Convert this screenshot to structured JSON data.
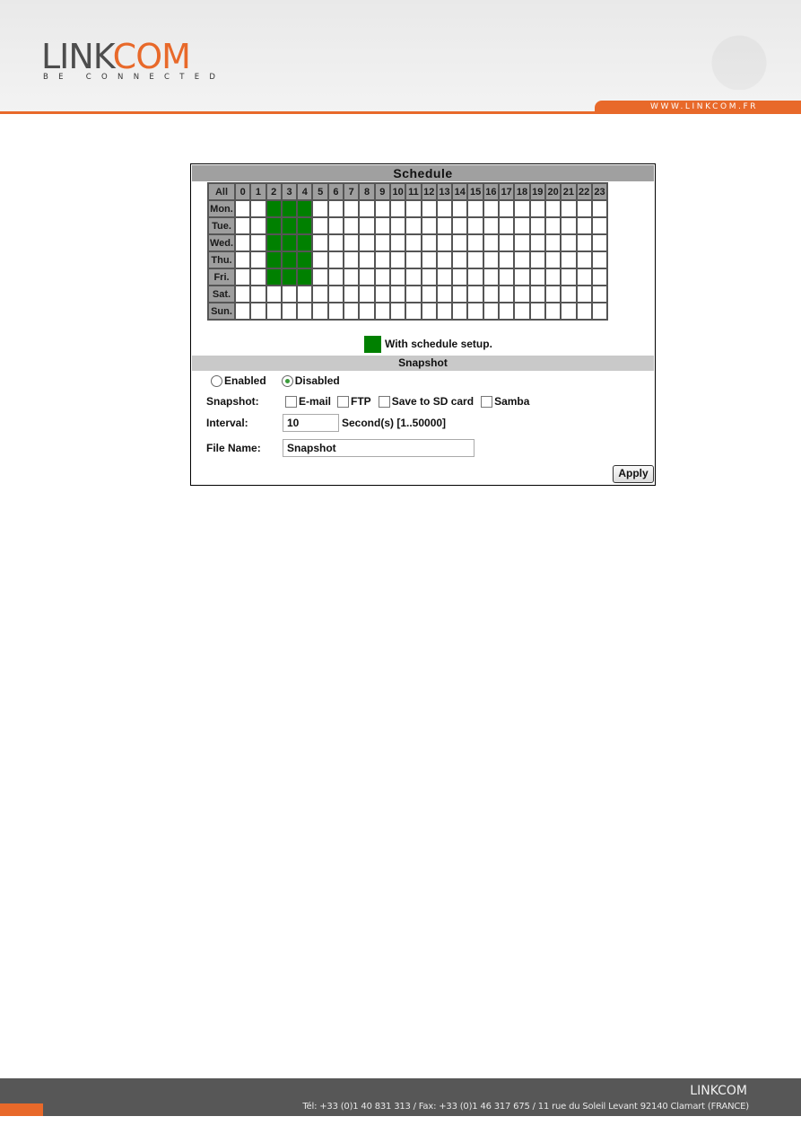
{
  "header": {
    "logo": {
      "part1": "LINK",
      "part2": "COM",
      "tagline": "BE CONNECTED"
    },
    "website": "WWW.LINKCOM.FR"
  },
  "schedule": {
    "title": "Schedule",
    "all_label": "All",
    "hours": [
      "0",
      "1",
      "2",
      "3",
      "4",
      "5",
      "6",
      "7",
      "8",
      "9",
      "10",
      "11",
      "12",
      "13",
      "14",
      "15",
      "16",
      "17",
      "18",
      "19",
      "20",
      "21",
      "22",
      "23"
    ],
    "days": [
      {
        "label": "Mon.",
        "active_hours": [
          2,
          3,
          4
        ]
      },
      {
        "label": "Tue.",
        "active_hours": [
          2,
          3,
          4
        ]
      },
      {
        "label": "Wed.",
        "active_hours": [
          2,
          3,
          4
        ]
      },
      {
        "label": "Thu.",
        "active_hours": [
          2,
          3,
          4
        ]
      },
      {
        "label": "Fri.",
        "active_hours": [
          2,
          3,
          4
        ]
      },
      {
        "label": "Sat.",
        "active_hours": []
      },
      {
        "label": "Sun.",
        "active_hours": []
      }
    ],
    "active_color": "#008000",
    "legend": "With schedule setup."
  },
  "snapshot": {
    "title": "Snapshot",
    "mode": {
      "options": [
        {
          "label": "Enabled",
          "checked": false
        },
        {
          "label": "Disabled",
          "checked": true
        }
      ]
    },
    "targets_label": "Snapshot:",
    "targets": [
      {
        "label": "E-mail",
        "checked": false
      },
      {
        "label": "FTP",
        "checked": false
      },
      {
        "label": "Save to SD card",
        "checked": false
      },
      {
        "label": "Samba",
        "checked": false
      }
    ],
    "interval_label": "Interval:",
    "interval_value": "10",
    "interval_hint": "Second(s) [1..50000]",
    "filename_label": "File Name:",
    "filename_value": "Snapshot",
    "apply_label": "Apply"
  },
  "footer": {
    "company": "LINKCOM",
    "address": "Tél: +33 (0)1 40 831 313 / Fax: +33 (0)1 46 317 675 / 11 rue du Soleil Levant 92140 Clamart (FRANCE)"
  }
}
